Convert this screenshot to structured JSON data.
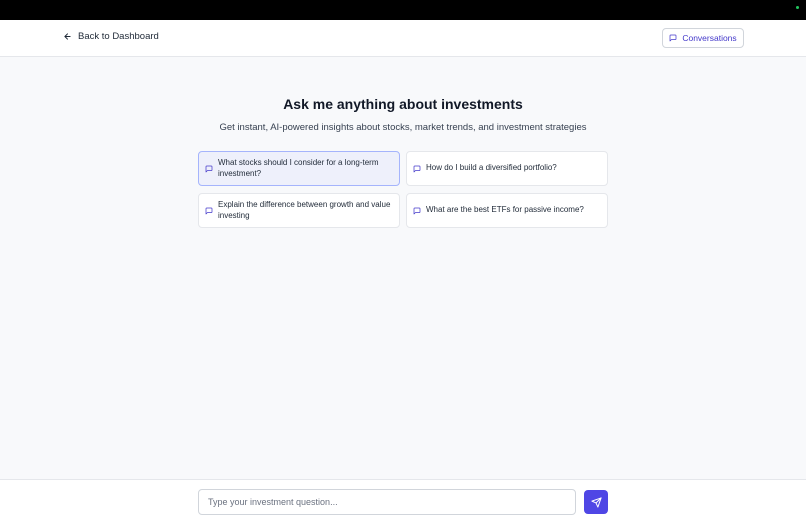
{
  "header": {
    "back_label": "Back to Dashboard",
    "conversations_label": "Conversations"
  },
  "main": {
    "title": "Ask me anything about investments",
    "subtitle": "Get instant, AI-powered insights about stocks, market trends, and investment strategies",
    "suggestions": [
      {
        "text": "What stocks should I consider for a long-term investment?",
        "icon": "message-square-icon",
        "selected": true
      },
      {
        "text": "How do I build a diversified portfolio?",
        "icon": "message-square-icon",
        "selected": false
      },
      {
        "text": "Explain the difference between growth and value investing",
        "icon": "message-square-icon",
        "selected": false
      },
      {
        "text": "What are the best ETFs for passive income?",
        "icon": "message-square-icon",
        "selected": false
      }
    ]
  },
  "composer": {
    "placeholder": "Type your investment question...",
    "send_icon": "send-icon"
  },
  "colors": {
    "accent": "#4f46e5",
    "selected_card_bg": "#eef0fb"
  }
}
